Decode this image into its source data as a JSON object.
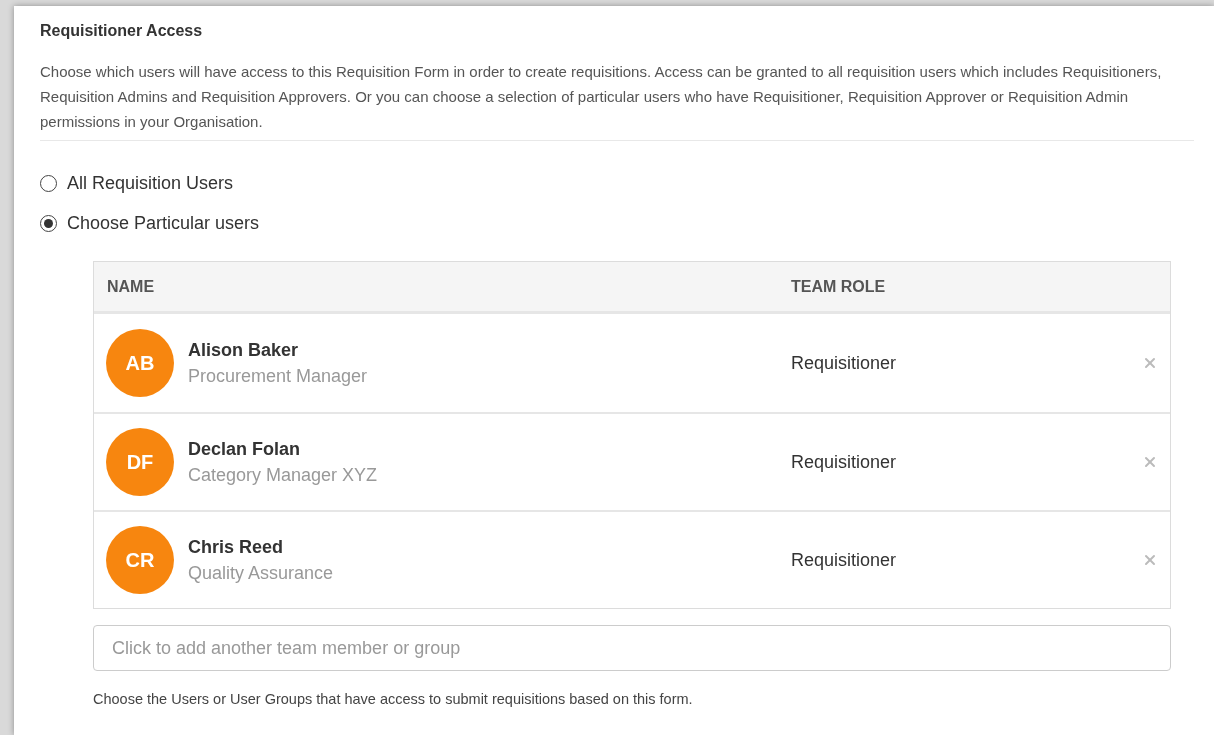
{
  "section": {
    "title": "Requisitioner Access",
    "description": "Choose which users will have access to this Requisition Form in order to create requisitions. Access can be granted to all requisition users which includes Requisitioners, Requisition Admins and Requisition Approvers. Or you can choose a selection of particular users who have Requisitioner, Requisition Approver or Requisition Admin permissions in your Organisation."
  },
  "access_options": [
    {
      "label": "All Requisition Users",
      "selected": false
    },
    {
      "label": "Choose Particular users",
      "selected": true
    }
  ],
  "table": {
    "columns": [
      "NAME",
      "TEAM ROLE"
    ],
    "rows": [
      {
        "initials": "AB",
        "name": "Alison Baker",
        "title": "Procurement Manager",
        "role": "Requisitioner"
      },
      {
        "initials": "DF",
        "name": "Declan Folan",
        "title": "Category Manager XYZ",
        "role": "Requisitioner"
      },
      {
        "initials": "CR",
        "name": "Chris Reed",
        "title": "Quality Assurance",
        "role": "Requisitioner"
      }
    ]
  },
  "add_field": {
    "placeholder": "Click to add another team member or group"
  },
  "hint": "Choose the Users or User Groups that have access to submit requisitions based on this form."
}
